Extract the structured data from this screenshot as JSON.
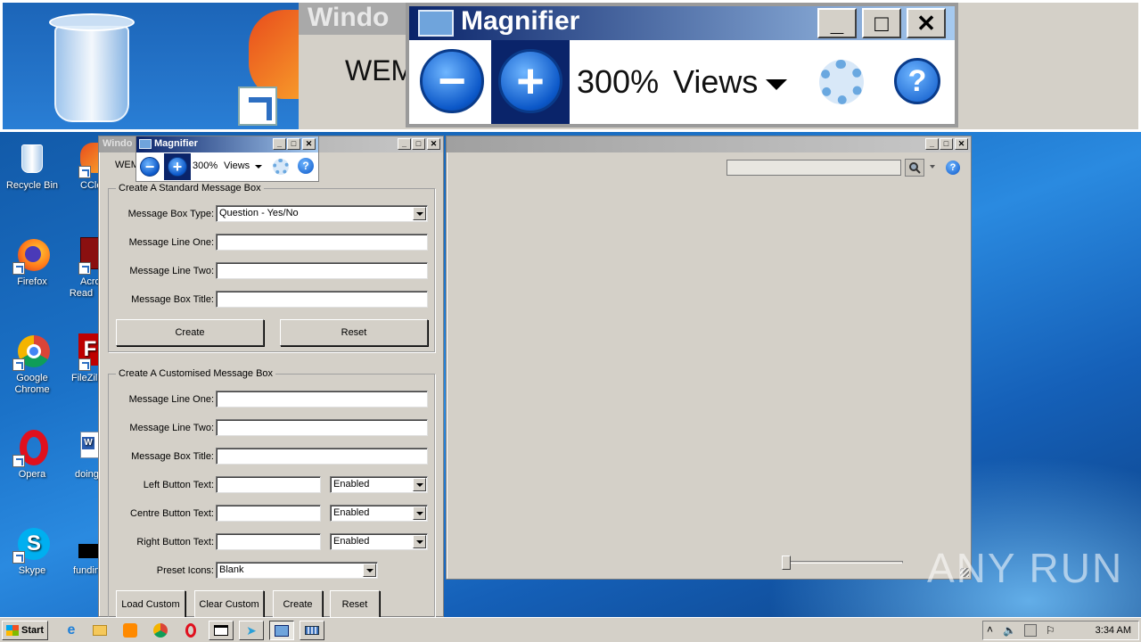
{
  "zoom": {
    "window_title": "Windo",
    "wem_text": "WEM",
    "magnifier_title": "Magnifier",
    "zoom_level": "300%",
    "views_label": "Views"
  },
  "desktop_icons": [
    {
      "label": "Recycle Bin"
    },
    {
      "label": "CCle"
    },
    {
      "label": "Firefox"
    },
    {
      "label": "Acro Read"
    },
    {
      "label": "Google Chrome"
    },
    {
      "label": "FileZilla"
    },
    {
      "label": "Opera"
    },
    {
      "label": "doingd"
    },
    {
      "label": "Skype"
    },
    {
      "label": "funding"
    }
  ],
  "form_window": {
    "title": "Windo",
    "menu_text": "WEM",
    "standard_group": {
      "label": "Create A Standard Message Box",
      "type_label": "Message Box Type:",
      "type_value": "Question - Yes/No",
      "line_one_label": "Message Line One:",
      "line_two_label": "Message Line Two:",
      "title_label": "Message Box Title:",
      "create_label": "Create",
      "reset_label": "Reset"
    },
    "custom_group": {
      "label": "Create A Customised Message Box",
      "line_one_label": "Message Line One:",
      "line_two_label": "Message Line Two:",
      "title_label": "Message Box Title:",
      "left_button_label": "Left Button Text:",
      "left_button_state": "Enabled",
      "centre_button_label": "Centre Button Text:",
      "centre_button_state": "Enabled",
      "right_button_label": "Right Button Text:",
      "right_button_state": "Enabled",
      "preset_icons_label": "Preset Icons:",
      "preset_icons_value": "Blank",
      "load_custom_label": "Load Custom",
      "clear_custom_label": "Clear Custom",
      "create_label": "Create",
      "reset_label": "Reset"
    }
  },
  "magnifier_small": {
    "title": "Magnifier",
    "zoom_level": "300%",
    "views_label": "Views"
  },
  "watermark": "ANY RUN",
  "taskbar": {
    "start_label": "Start",
    "clock": "3:34 AM"
  },
  "colors": {
    "title_active": "#0a246a",
    "title_gradient_end": "#a6caf0",
    "window_face": "#d4d0c8",
    "desktop": "#1b72c8"
  }
}
